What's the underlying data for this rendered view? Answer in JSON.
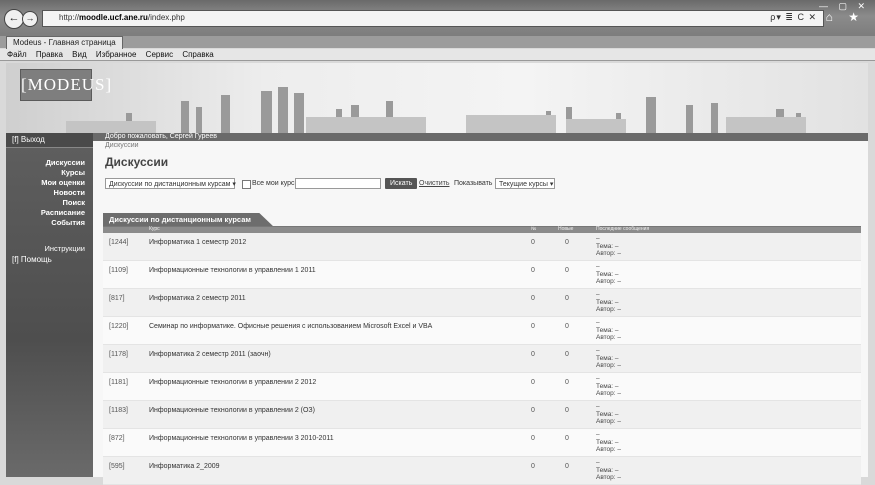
{
  "browser": {
    "url_prefix": "http://",
    "url_host": "moodle.ucf.ane.ru",
    "url_path": "/index.php",
    "tab_title": "Modeus - Главная страница",
    "menu": [
      "Файл",
      "Правка",
      "Вид",
      "Избранное",
      "Сервис",
      "Справка"
    ],
    "nav_back": "←",
    "nav_fwd": "→",
    "addr_tools": "ρ▾ ≣ C ✕",
    "window_controls": "— ▢ ✕",
    "home_star": "⌂ ★"
  },
  "site": {
    "logo": "[MODEUS]",
    "login_link": "[f] Выход",
    "welcome": "Добро пожаловать, Сергей Гуреев",
    "breadcrumb": "Дискуссии",
    "page_title": "Дискуссии"
  },
  "sidebar": {
    "items": [
      "Дискуссии",
      "Курсы",
      "Мои оценки",
      "Новости",
      "Поиск",
      "Расписание",
      "События"
    ],
    "instructions": "Инструкции",
    "help": "[f] Помощь"
  },
  "filters": {
    "course_select": "Дискуссии по дистанционным курсам",
    "checkbox_label": "Все мои курсы / по курсам",
    "search_button": "Искать",
    "clear_link": "Очистить",
    "show_label": "Показывать",
    "show_select": "Текущие курсы"
  },
  "section": {
    "title": "Дискуссии по дистанционным курсам",
    "col_name": "Курс",
    "col_n1": "№",
    "col_n2": "Новые",
    "col_last": "Последние сообщения"
  },
  "rows": [
    {
      "id": "[1244]",
      "name": "Информатика 1 семестр 2012",
      "n1": "0",
      "n2": "0",
      "l1": "–",
      "l2": "Тема: –",
      "l3": "Автор: –"
    },
    {
      "id": "[1109]",
      "name": "Информационные технологии в управлении 1 2011",
      "n1": "0",
      "n2": "0",
      "l1": "–",
      "l2": "Тема: –",
      "l3": "Автор: –"
    },
    {
      "id": "[817]",
      "name": "Информатика 2 семестр 2011",
      "n1": "0",
      "n2": "0",
      "l1": "–",
      "l2": "Тема: –",
      "l3": "Автор: –"
    },
    {
      "id": "[1220]",
      "name": "Семинар по информатике. Офисные решения с использованием Microsoft Excel и VBA",
      "n1": "0",
      "n2": "0",
      "l1": "–",
      "l2": "Тема: –",
      "l3": "Автор: –"
    },
    {
      "id": "[1178]",
      "name": "Информатика 2 семестр 2011 (заочн)",
      "n1": "0",
      "n2": "0",
      "l1": "–",
      "l2": "Тема: –",
      "l3": "Автор: –"
    },
    {
      "id": "[1181]",
      "name": "Информационные технологии в управлении 2 2012",
      "n1": "0",
      "n2": "0",
      "l1": "–",
      "l2": "Тема: –",
      "l3": "Автор: –"
    },
    {
      "id": "[1183]",
      "name": "Информационные технологии в управлении 2 (ОЗ)",
      "n1": "0",
      "n2": "0",
      "l1": "–",
      "l2": "Тема: –",
      "l3": "Автор: –"
    },
    {
      "id": "[872]",
      "name": "Информационные технологии в управлении 3 2010-2011",
      "n1": "0",
      "n2": "0",
      "l1": "–",
      "l2": "Тема: –",
      "l3": "Автор: –"
    },
    {
      "id": "[595]",
      "name": "Информатика 2_2009",
      "n1": "0",
      "n2": "0",
      "l1": "–",
      "l2": "Тема: –",
      "l3": "Автор: –"
    }
  ]
}
